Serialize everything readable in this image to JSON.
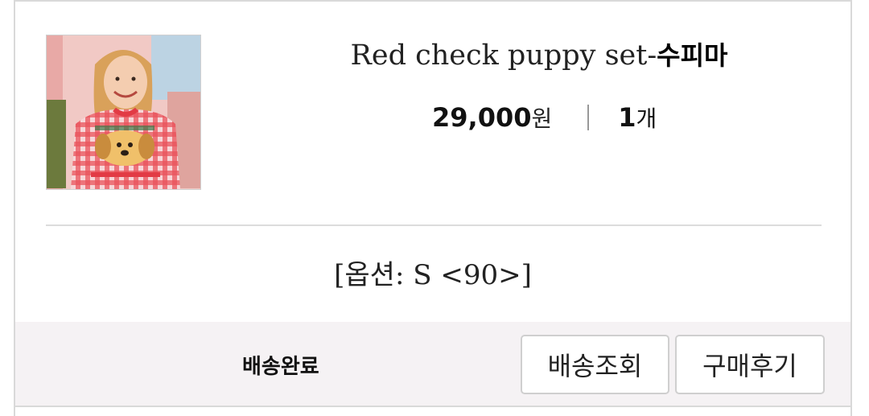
{
  "product": {
    "name": "Red check puppy set-",
    "brand": "수피마",
    "price": "29,000",
    "price_unit": "원",
    "quantity": "1",
    "quantity_unit": "개",
    "option": "[옵션: S <90>]",
    "image_alt": "child wearing red check puppy set"
  },
  "order": {
    "status": "배송완료",
    "track_button": "배송조회",
    "review_button": "구매후기"
  },
  "colors": {
    "footer_bg": "#f5f2f4",
    "divider": "#dcdcdc",
    "shirt_red": "#e23b45"
  }
}
